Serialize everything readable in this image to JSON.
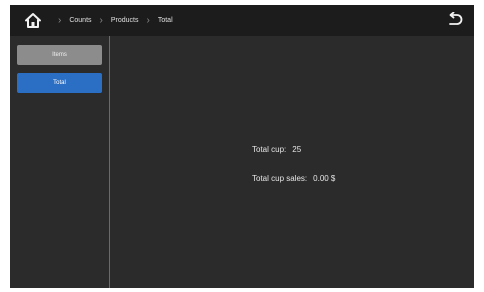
{
  "header": {
    "home_icon": "home-icon",
    "breadcrumbs": [
      "Counts",
      "Products",
      "Total"
    ],
    "separator_icon": "chevron-right-icon",
    "back_icon": "undo-arrow-icon"
  },
  "sidebar": {
    "items": [
      {
        "label": "Items",
        "active": false
      },
      {
        "label": "Total",
        "active": true
      }
    ]
  },
  "main": {
    "total_cup_label": "Total cup:",
    "total_cup_value": "25",
    "total_cup_sales_label": "Total cup sales:",
    "total_cup_sales_value": "0.00 $"
  },
  "colors": {
    "background": "#2b2b2b",
    "topbar": "#1c1c1c",
    "accent": "#2b6fc4",
    "inactive_button": "#8c8c8c"
  }
}
